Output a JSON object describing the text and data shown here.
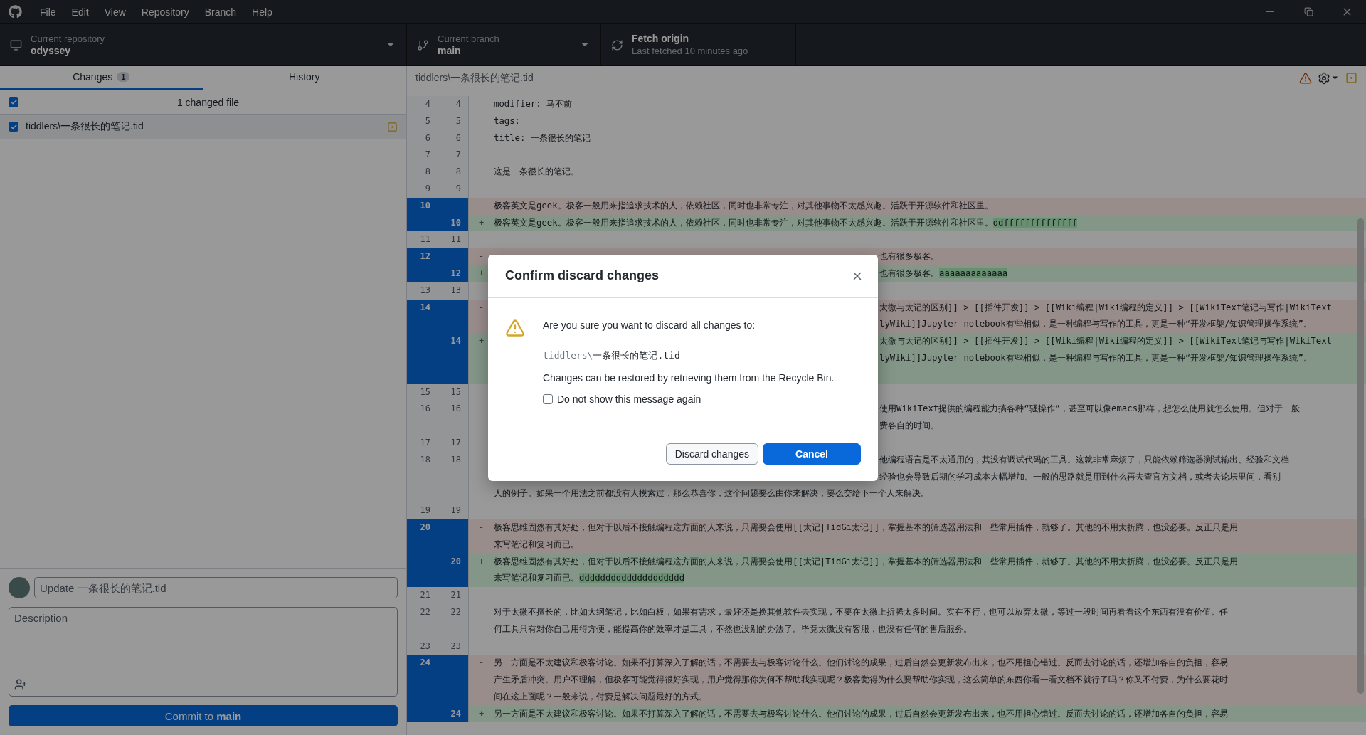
{
  "app_menu": [
    "File",
    "Edit",
    "View",
    "Repository",
    "Branch",
    "Help"
  ],
  "toolbar": {
    "repository": {
      "label": "Current repository",
      "value": "odyssey"
    },
    "branch": {
      "label": "Current branch",
      "value": "main"
    },
    "fetch": {
      "label": "Fetch origin",
      "detail": "Last fetched 10 minutes ago"
    }
  },
  "tabs": [
    {
      "label": "Changes",
      "badge": "1",
      "selected": true
    },
    {
      "label": "History",
      "selected": false
    }
  ],
  "changes": {
    "select_all_checked": true,
    "summary": "1 changed file",
    "files": [
      {
        "path": "tiddlers\\一条很长的笔记.tid",
        "checked": true,
        "selected": true,
        "kind": "modified"
      }
    ]
  },
  "commit": {
    "summary_placeholder": "Update 一条很长的笔记.tid",
    "description_placeholder": "Description",
    "button": "Commit to **main**"
  },
  "diff": {
    "file": "tiddlers\\一条很长的笔记.tid",
    "rows": [
      {
        "old": "4",
        "new": "4",
        "kind": "context",
        "lines": [
          {
            "text": "modifier: 马不前"
          }
        ]
      },
      {
        "old": "5",
        "new": "5",
        "kind": "context",
        "lines": [
          {
            "text": "tags:"
          }
        ]
      },
      {
        "old": "6",
        "new": "6",
        "kind": "context",
        "lines": [
          {
            "text": "title: 一条很长的笔记"
          }
        ]
      },
      {
        "old": "7",
        "new": "7",
        "kind": "context"
      },
      {
        "old": "8",
        "new": "8",
        "kind": "context",
        "lines": [
          {
            "text": "这是一条很长的笔记。"
          }
        ]
      },
      {
        "old": "9",
        "new": "9",
        "kind": "context"
      },
      {
        "old": "10",
        "kind": "deleted",
        "sign": "-",
        "selected": true,
        "lines": [
          {
            "text": "极客英文是geek。极客一般用来指追求技术的人，依赖社区，同时也非常专注，对其他事物不太感兴趣。活跃于开源软件和社区里。"
          }
        ]
      },
      {
        "new": "10",
        "kind": "added",
        "sign": "+",
        "selected": true,
        "lines": [
          {
            "text": "极客英文是geek。极客一般用来指追求技术的人，依赖社区，同时也非常专注，对其他事物不太感兴趣。活跃于开源软件和社区里。",
            "highlight": "ddffffffffffffff"
          }
        ]
      },
      {
        "old": "11",
        "new": "11",
        "kind": "context"
      },
      {
        "old": "12",
        "kind": "deleted",
        "sign": "-",
        "selected": true,
        "lines": [
          {
            "text": "也有很多极客。",
            "covered": true
          }
        ]
      },
      {
        "new": "12",
        "kind": "added",
        "sign": "+",
        "selected": true,
        "lines": [
          {
            "text": "也有很多极客。",
            "highlight": "aaaaaaaaaaaaa",
            "covered": true
          }
        ]
      },
      {
        "old": "13",
        "new": "13",
        "kind": "context"
      },
      {
        "old": "14",
        "kind": "deleted",
        "sign": "-",
        "selected": true,
        "lines": [
          {
            "text": "太微与太记的区别]] > [[插件开发]] > [[Wiki编程|Wiki编程的定义]] > [[WikiText笔记与写作|WikiText",
            "covered": true
          },
          {
            "text": "lyWiki]]Jupyter notebook有些相似，是一种编程与写作的工具，更是一种“开发框架/知识管理操作系统”。",
            "covered": true
          }
        ]
      },
      {
        "new": "14",
        "kind": "added",
        "sign": "+",
        "selected": true,
        "hidden_tail": true,
        "lines": [
          {
            "text": "太微与太记的区别]] > [[插件开发]] > [[Wiki编程|Wiki编程的定义]] > [[WikiText笔记与写作|WikiText",
            "covered": true
          },
          {
            "text": "lyWiki]]Jupyter notebook有些相似，是一种编程与写作的工具，更是一种“开发框架/知识管理操作系统”。",
            "covered": true
          }
        ]
      },
      {
        "old": "15",
        "new": "15",
        "kind": "context"
      },
      {
        "old": "16",
        "new": "16",
        "kind": "context",
        "lines": [
          {
            "text": "使用WikiText提供的编程能力搞各种“骚操作”，甚至可以像emacs那样，想怎么使用就怎么使用。但对于一般",
            "covered": true
          },
          {
            "text": "费各自的时间。",
            "covered": true
          }
        ]
      },
      {
        "old": "17",
        "new": "17",
        "kind": "context"
      },
      {
        "old": "18",
        "new": "18",
        "kind": "context",
        "lines": [
          {
            "text": "他编程语言是不太通用的，其没有调试代码的工具。这就非常麻烦了，只能依赖筛选器测试输出、经验和文档",
            "covered": true
          },
          {
            "text": "经验也会导致后期的学习成本大幅增加。一般的思路就是用到什么再去查官方文档，或者去论坛里问，看别",
            "covered": true
          },
          {
            "text": "人的例子。如果一个用法之前都没有人摸索过，那么恭喜你，这个问题要么由你来解决，要么交给下一个人来解决。"
          }
        ]
      },
      {
        "old": "19",
        "new": "19",
        "kind": "context"
      },
      {
        "old": "20",
        "kind": "deleted",
        "sign": "-",
        "selected": true,
        "lines": [
          {
            "text": "极客思维固然有其好处，但对于以后不接触编程这方面的人来说，只需要会使用[[太记|TidGi太记]]，掌握基本的筛选器用法和一些常用插件，就够了。其他的不用太折腾，也没必要。反正只是用"
          },
          {
            "text": "来写笔记和复习而已。"
          }
        ]
      },
      {
        "new": "20",
        "kind": "added",
        "sign": "+",
        "selected": true,
        "lines": [
          {
            "text": "极客思维固然有其好处，但对于以后不接触编程这方面的人来说，只需要会使用[[太记|TidGi太记]]，掌握基本的筛选器用法和一些常用插件，就够了。其他的不用太折腾，也没必要。反正只是用"
          },
          {
            "text": "来写笔记和复习而已。",
            "highlight": "dddddddddddddddddddd"
          }
        ]
      },
      {
        "old": "21",
        "new": "21",
        "kind": "context"
      },
      {
        "old": "22",
        "new": "22",
        "kind": "context",
        "lines": [
          {
            "text": "对于太微不擅长的，比如大纲笔记，比如白板，如果有需求，最好还是换其他软件去实现，不要在太微上折腾太多时间。实在不行，也可以放弃太微，等过一段时间再看看这个东西有没有价值。任"
          },
          {
            "text": "何工具只有对你自己用得方便，能提高你的效率才是工具，不然也没别的办法了。毕竟太微没有客服，也没有任何的售后服务。"
          }
        ]
      },
      {
        "old": "23",
        "new": "23",
        "kind": "context"
      },
      {
        "old": "24",
        "kind": "deleted",
        "sign": "-",
        "selected": true,
        "lines": [
          {
            "text": "另一方面是不太建议和极客讨论。如果不打算深入了解的话，不需要去与极客讨论什么。他们讨论的成果，过后自然会更新发布出来，也不用担心错过。反而去讨论的话，还增加各自的负担，容易"
          },
          {
            "text": "产生矛盾冲突。用户不理解，但极客可能觉得很好实现，用户觉得那你为何不帮助我实现呢？极客觉得为什么要帮助你实现，这么简单的东西你看一看文档不就行了吗？你又不付费，为什么要花时"
          },
          {
            "text": "间在这上面呢？一般来说，付费是解决问题最好的方式。"
          }
        ]
      },
      {
        "new": "24",
        "kind": "added",
        "sign": "+",
        "selected": true,
        "lines": [
          {
            "text": "另一方面是不太建议和极客讨论。如果不打算深入了解的话，不需要去与极客讨论什么。他们讨论的成果，过后自然会更新发布出来，也不用担心错过。反而去讨论的话，还增加各自的负担，容易"
          }
        ]
      }
    ]
  },
  "dialog": {
    "title": "Confirm discard changes",
    "message": "Are you sure you want to discard all changes to:",
    "path": {
      "directory": "tiddlers\\",
      "name": "一条很长的笔记.tid"
    },
    "note": "Changes can be restored by retrieving them from the Recycle Bin.",
    "dont_show_again": {
      "label": "Do not show this message again",
      "checked": false
    },
    "buttons": [
      {
        "label": "Discard changes",
        "kind": "secondary"
      },
      {
        "label": "Cancel",
        "kind": "primary"
      }
    ]
  }
}
